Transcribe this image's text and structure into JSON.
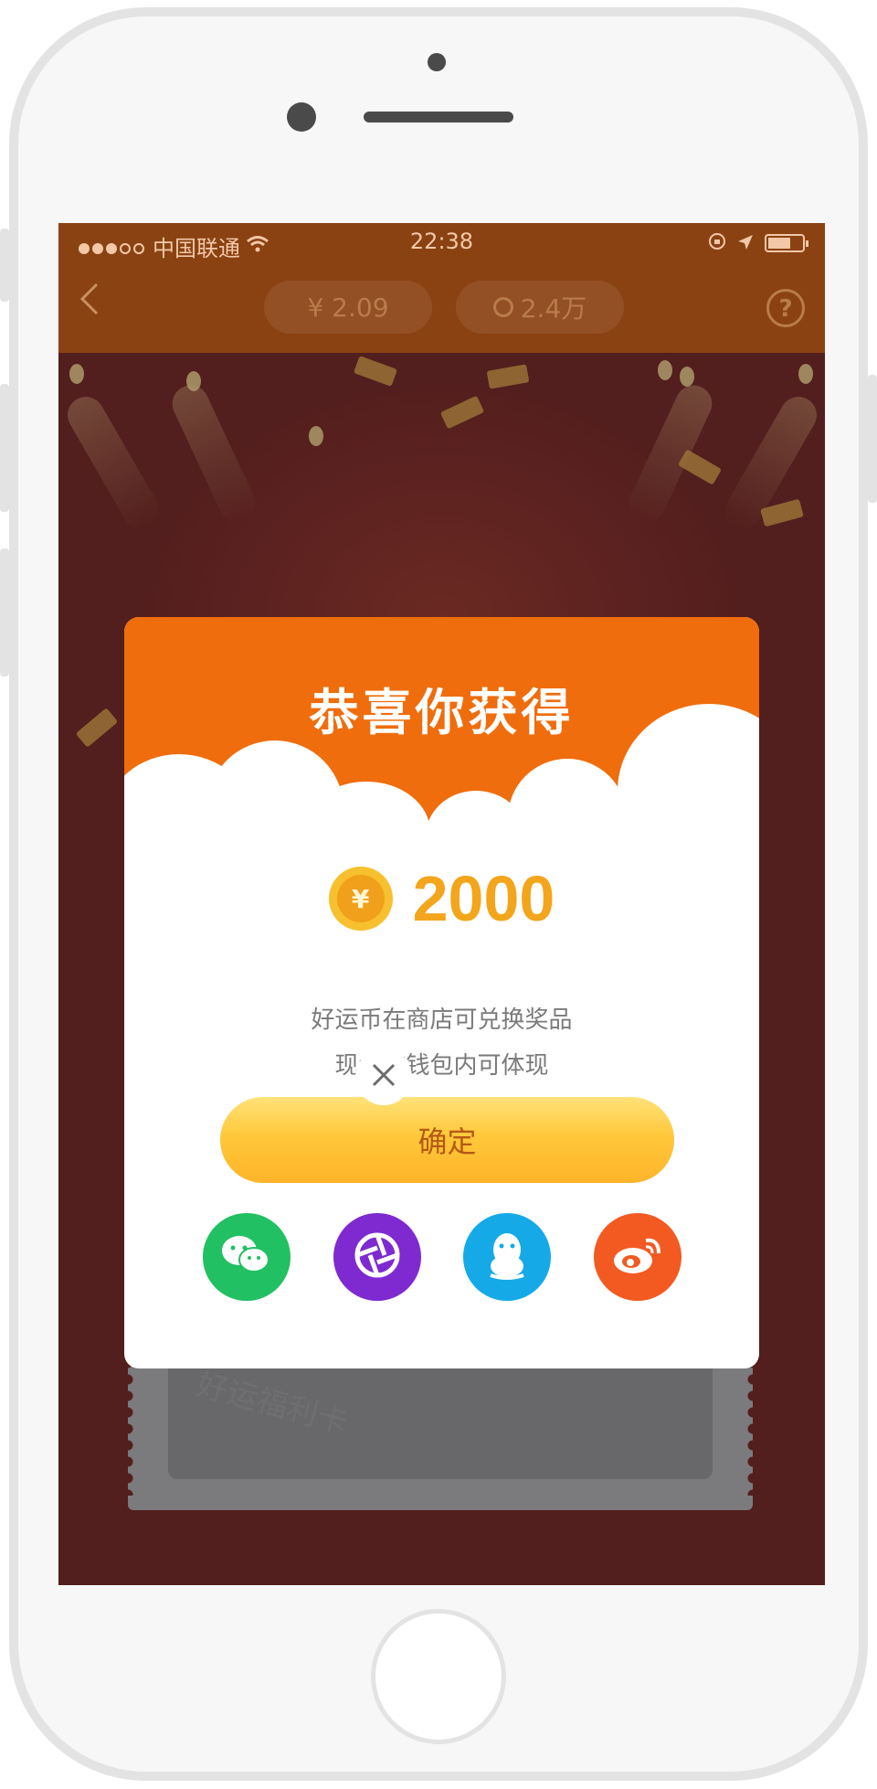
{
  "status_bar": {
    "carrier": "中国联通",
    "time": "22:38"
  },
  "header": {
    "cash_balance": "¥ 2.09",
    "coin_balance": "2.4万"
  },
  "dialog": {
    "title": "恭喜你获得",
    "amount": "2000",
    "coin_symbol": "¥",
    "description_line1": "好运币在商店可兑换奖品",
    "description_line2": "现金在钱包内可体现",
    "confirm_label": "确定"
  },
  "share": {
    "targets": [
      "wechat-icon",
      "moments-icon",
      "qq-icon",
      "weibo-icon"
    ]
  },
  "background_card": {
    "watermark": "好运福利卡"
  },
  "colors": {
    "dialog_header": "#ef6d0c",
    "amount": "#f3a51b",
    "wechat": "#21c063",
    "moments": "#7e2ad0",
    "qq": "#15a9e8",
    "weibo": "#f35a22"
  }
}
